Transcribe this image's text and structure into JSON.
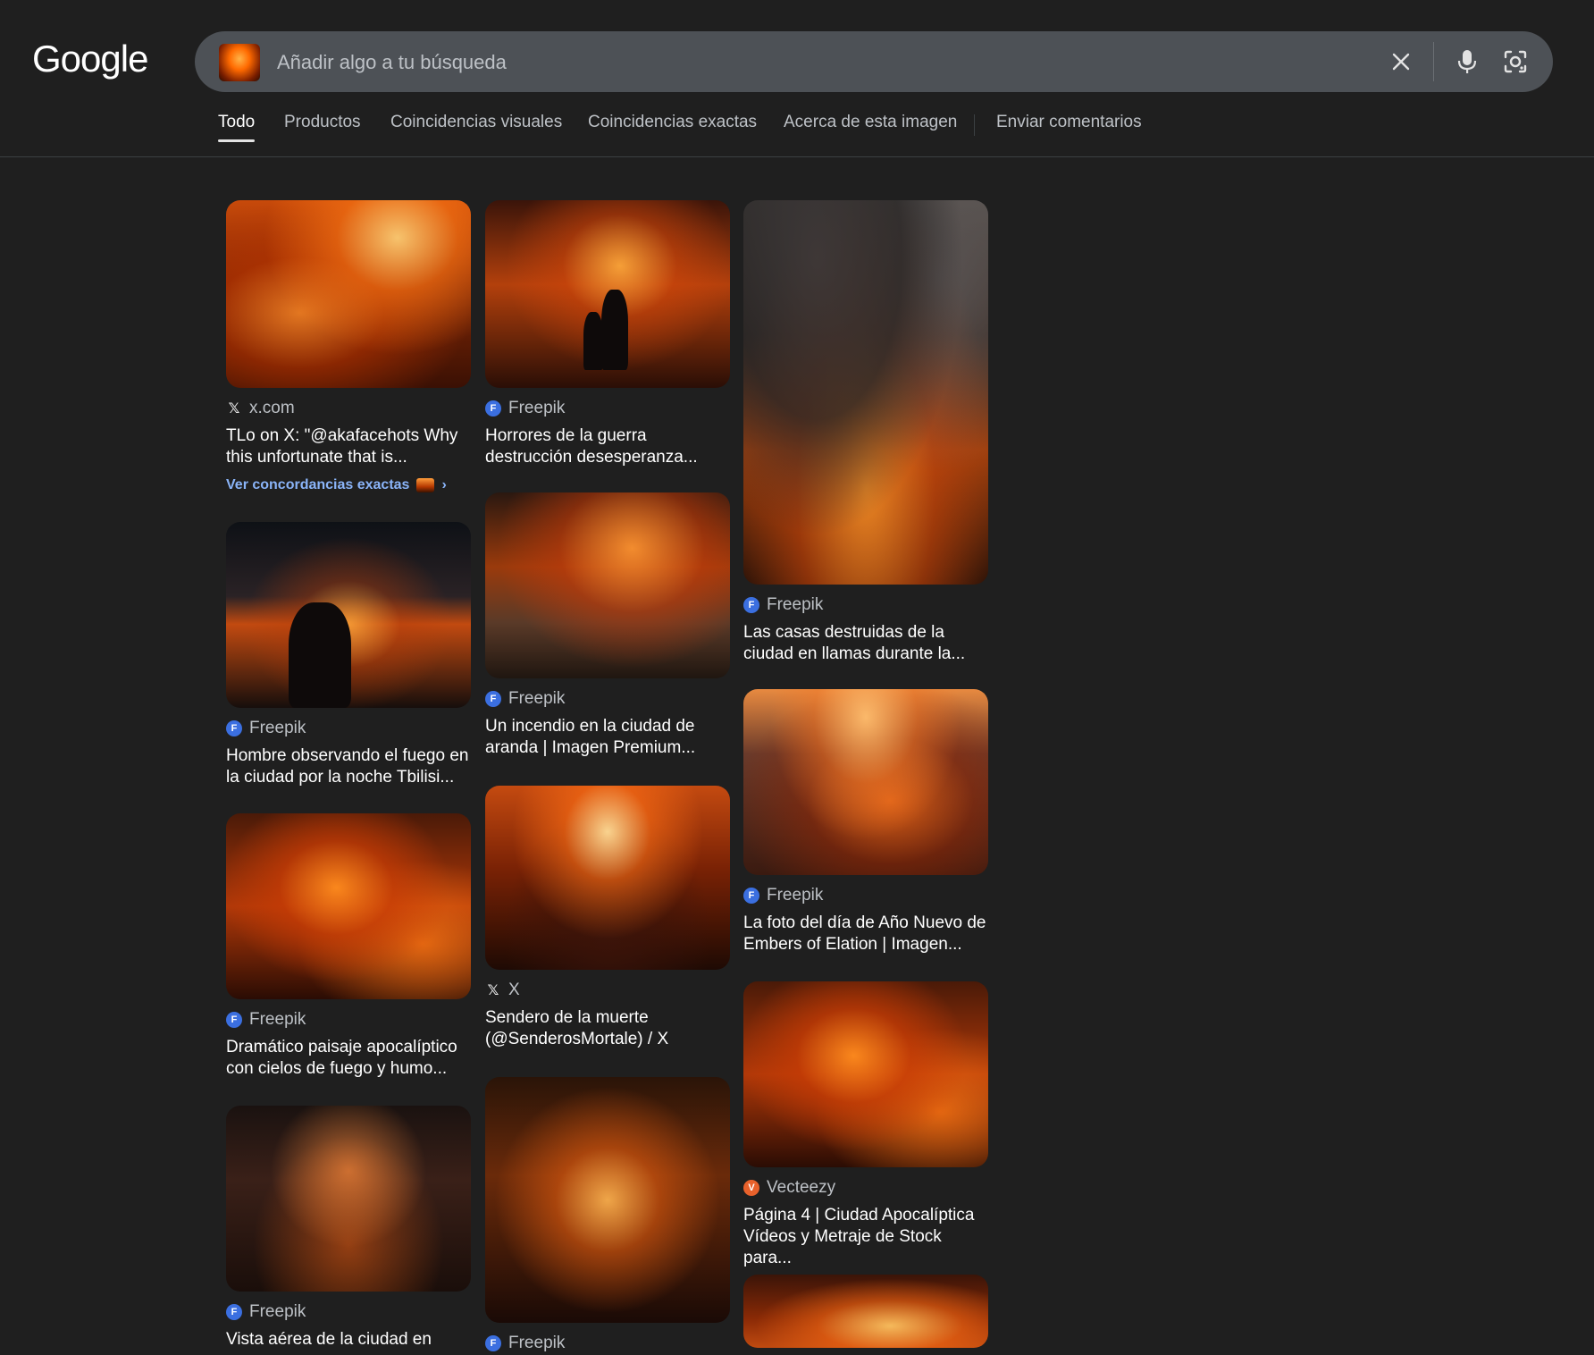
{
  "header": {
    "logo": "Google",
    "search": {
      "placeholder": "Añadir algo a tu búsqueda",
      "value": ""
    }
  },
  "icons": {
    "clear": "close-icon",
    "voice": "microphone-icon",
    "lens": "lens-camera-icon"
  },
  "tabs": [
    {
      "label": "Todo",
      "active": true
    },
    {
      "label": "Productos"
    },
    {
      "label": "Coincidencias visuales"
    },
    {
      "label": "Coincidencias exactas"
    },
    {
      "label": "Acerca de esta imagen"
    },
    {
      "label": "Enviar comentarios"
    }
  ],
  "results": {
    "col1": [
      {
        "source": "x.com",
        "source_icon": "x-logo-icon",
        "title_line1": "TLo on X: \"@akafacehots Why",
        "title_line2": "this unfortunate that is...",
        "exact_link": "Ver concordancias exactas"
      },
      {
        "source": "Freepik",
        "source_icon": "freepik-icon",
        "title_line1": "Hombre observando el fuego en",
        "title_line2": "la ciudad por la noche Tbilisi..."
      },
      {
        "source": "Freepik",
        "source_icon": "freepik-icon",
        "title_line1": "Dramático paisaje apocalíptico",
        "title_line2": "con cielos de fuego y humo..."
      },
      {
        "source": "Freepik",
        "source_icon": "freepik-icon",
        "title_line1": "Vista aérea de la ciudad en",
        "title_line2": ""
      }
    ],
    "col2": [
      {
        "source": "Freepik",
        "source_icon": "freepik-icon",
        "title_line1": "Horrores de la guerra",
        "title_line2": "destrucción desesperanza..."
      },
      {
        "source": "Freepik",
        "source_icon": "freepik-icon",
        "title_line1": "Un incendio en la ciudad de",
        "title_line2": "aranda | Imagen Premium..."
      },
      {
        "source": "X",
        "source_icon": "x-logo-icon",
        "title_line1": "Sendero de la muerte",
        "title_line2": "(@SenderosMortale) / X"
      },
      {
        "source": "Freepik",
        "source_icon": "freepik-icon",
        "title_line1": "",
        "title_line2": ""
      }
    ],
    "col3": [
      {
        "source": "Freepik",
        "source_icon": "freepik-icon",
        "title_line1": "Las casas destruidas de la",
        "title_line2": "ciudad en llamas durante la..."
      },
      {
        "source": "Freepik",
        "source_icon": "freepik-icon",
        "title_line1": "La foto del día de Año Nuevo de",
        "title_line2": "Embers of Elation | Imagen..."
      },
      {
        "source": "Vecteezy",
        "source_icon": "vecteezy-icon",
        "title_line1": "Página 4 | Ciudad Apocalíptica",
        "title_line2": "Vídeos y Metraje de Stock para..."
      }
    ]
  },
  "colors": {
    "background": "#1f1f1f",
    "search_bg": "#4d5156",
    "link": "#8ab4f8",
    "text_secondary": "#bdc1c6"
  }
}
